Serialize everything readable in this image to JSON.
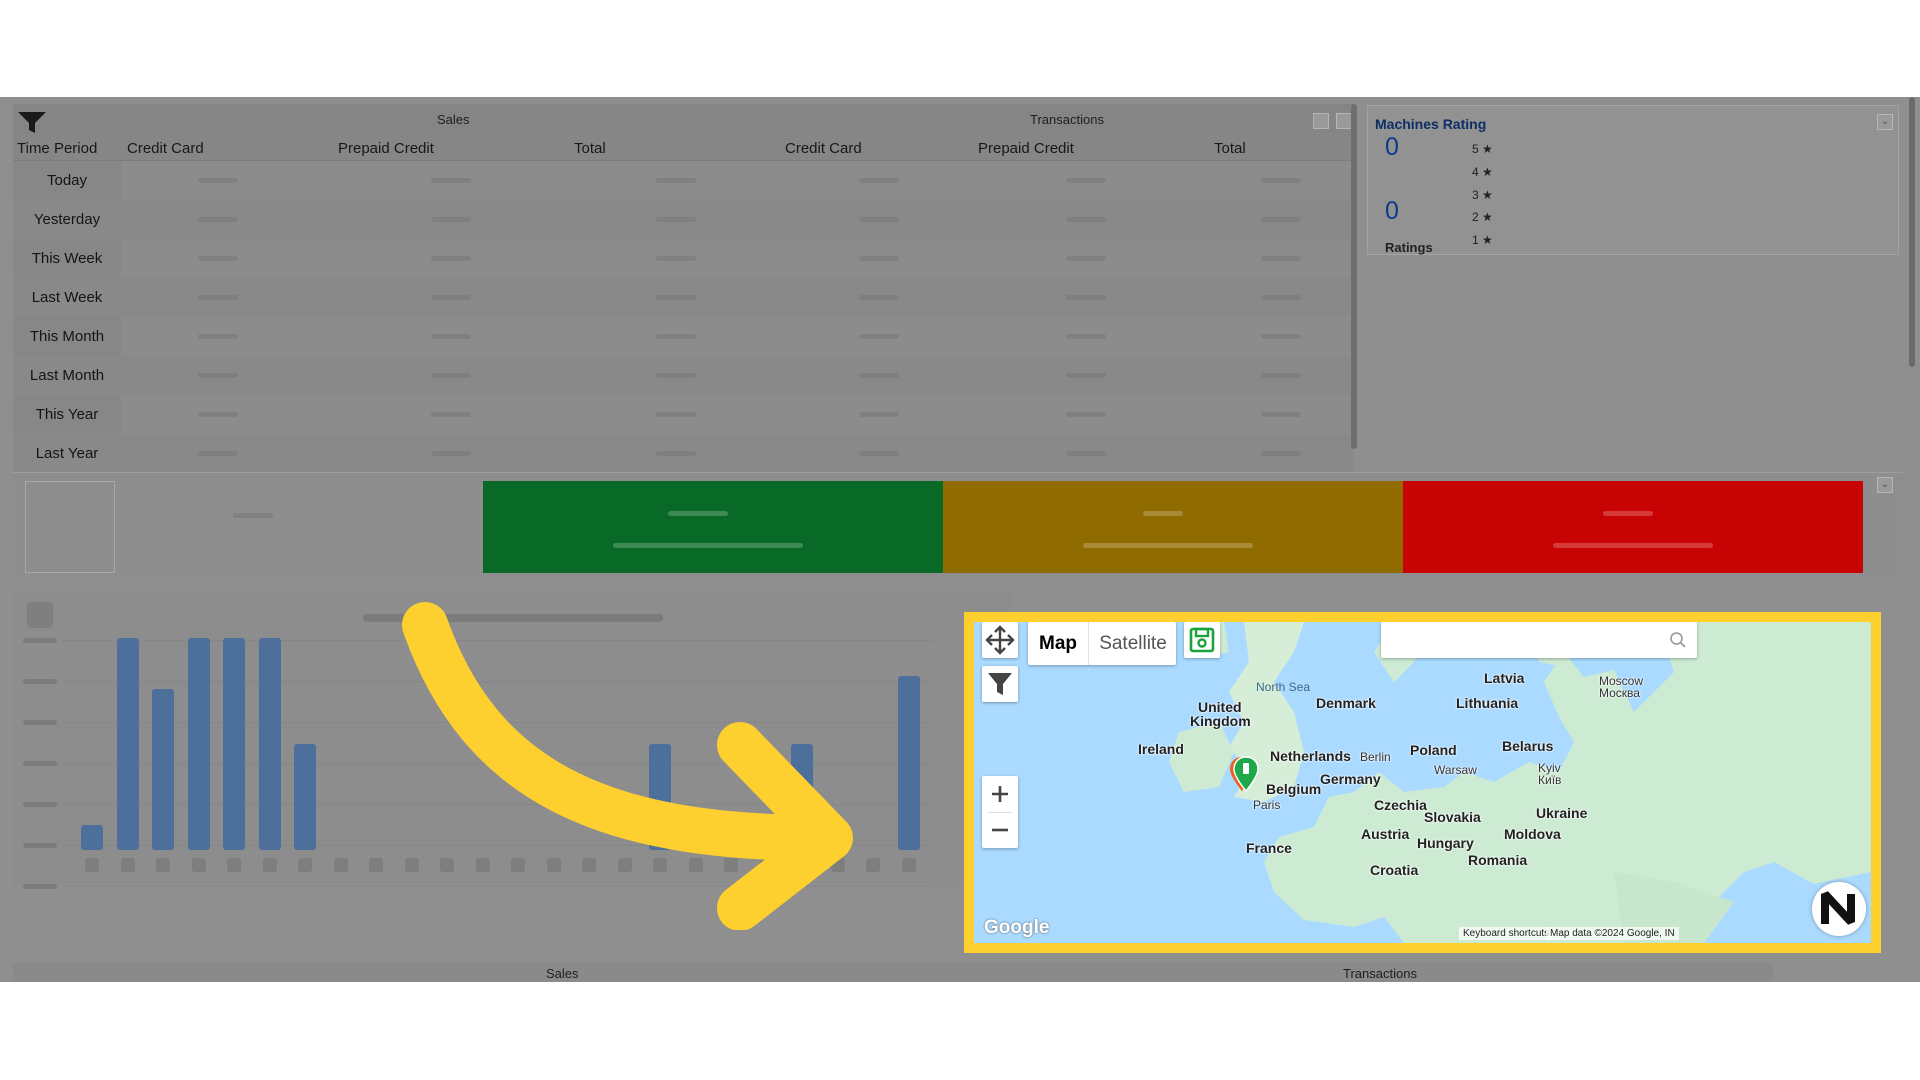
{
  "sales_table": {
    "group_sales": "Sales",
    "group_transactions": "Transactions",
    "headers": [
      "Time Period",
      "Credit Card",
      "Prepaid Credit",
      "Total",
      "Credit Card",
      "Prepaid Credit",
      "Total"
    ],
    "periods": [
      "Today",
      "Yesterday",
      "This Week",
      "Last Week",
      "This Month",
      "Last Month",
      "This Year",
      "Last Year"
    ]
  },
  "rating": {
    "title": "Machines Rating",
    "average": "0",
    "count": "0",
    "count_label": "Ratings",
    "stars": [
      "5 ★",
      "4 ★",
      "3 ★",
      "2 ★",
      "1 ★"
    ]
  },
  "status_colors": {
    "green": "#086a26",
    "amber": "#8f6b00",
    "red": "#c80303"
  },
  "chart_bars": [
    0.12,
    1.0,
    0.76,
    1.0,
    1.0,
    1.0,
    0.5,
    0,
    0,
    0,
    0,
    0,
    0,
    0,
    0,
    0,
    0.5,
    0,
    0,
    0,
    0.5,
    0,
    0,
    0.82
  ],
  "bottom_header": {
    "sales": "Sales",
    "transactions": "Transactions"
  },
  "map": {
    "mode_map": "Map",
    "mode_satellite": "Satellite",
    "search_placeholder": "",
    "icons": [
      "move-icon",
      "save-icon",
      "filter-icon",
      "search-icon",
      "zoom-in-icon",
      "zoom-out-icon",
      "pin-icon"
    ],
    "labels": {
      "north_sea": "North Sea",
      "denmark": "Denmark",
      "latvia": "Latvia",
      "moscow": "Moscow",
      "moscow_ru": "Москва",
      "lithuania": "Lithuania",
      "united_kingdom_1": "United",
      "united_kingdom_2": "Kingdom",
      "ireland": "Ireland",
      "netherlands": "Netherlands",
      "berlin": "Berlin",
      "poland": "Poland",
      "belarus": "Belarus",
      "warsaw": "Warsaw",
      "germany": "Germany",
      "kyiv": "Kyiv",
      "kyiv_ua": "Київ",
      "belgium": "Belgium",
      "paris": "Paris",
      "czechia": "Czechia",
      "slovakia": "Slovakia",
      "ukraine": "Ukraine",
      "austria": "Austria",
      "moldova": "Moldova",
      "hungary": "Hungary",
      "france": "France",
      "romania": "Romania",
      "croatia": "Croatia"
    },
    "footer_shortcuts": "Keyboard shortcuts",
    "footer_data": "Map data ©2024 Google, IN",
    "logo": "Google"
  },
  "accent": "#fdcf2f"
}
